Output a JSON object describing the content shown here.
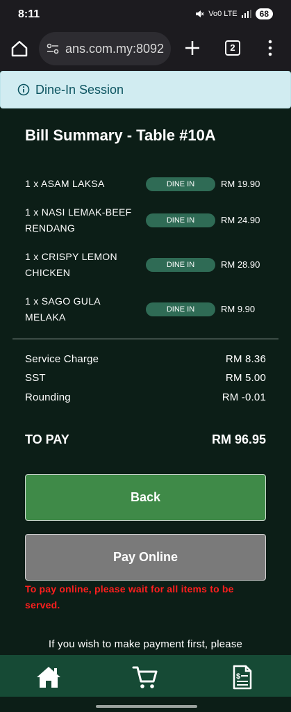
{
  "status_bar": {
    "time": "8:11",
    "network": "Vo0 LTE",
    "battery": "68"
  },
  "browser": {
    "url": "ans.com.my:8092",
    "tab_count": "2"
  },
  "session": {
    "label": "Dine-In Session"
  },
  "bill": {
    "title": "Bill Summary - Table #10A",
    "items": [
      {
        "name": "1 x ASAM LAKSA",
        "badge": "DINE IN",
        "price": "RM 19.90"
      },
      {
        "name": "1 x NASI LEMAK-BEEF RENDANG",
        "badge": "DINE IN",
        "price": "RM 24.90"
      },
      {
        "name": "1 x CRISPY LEMON CHICKEN",
        "badge": "DINE IN",
        "price": "RM 28.90"
      },
      {
        "name": "1 x SAGO GULA MELAKA",
        "badge": "DINE IN",
        "price": "RM 9.90"
      }
    ],
    "charges": [
      {
        "label": "Service Charge",
        "value": "RM 8.36"
      },
      {
        "label": "SST",
        "value": "RM 5.00"
      },
      {
        "label": "Rounding",
        "value": "RM -0.01"
      }
    ],
    "to_pay_label": "TO PAY",
    "to_pay_value": "RM 96.95"
  },
  "actions": {
    "back_label": "Back",
    "pay_online_label": "Pay Online",
    "pay_online_enabled": false
  },
  "messages": {
    "warning": "To pay online, please wait for all items to be served.",
    "info": "If you wish to make payment first, please"
  },
  "bottom_nav": {
    "items": [
      {
        "icon": "home-icon"
      },
      {
        "icon": "cart-icon"
      },
      {
        "icon": "receipt-icon"
      }
    ]
  },
  "colors": {
    "page_bg": "#0c1e17",
    "badge_bg": "#2f6b55",
    "back_button": "#3f8a48",
    "disabled_button": "#7a7a7a",
    "warning": "#ff1e1e",
    "nav_bg": "#164a35",
    "banner_bg": "#d1ecf1"
  }
}
